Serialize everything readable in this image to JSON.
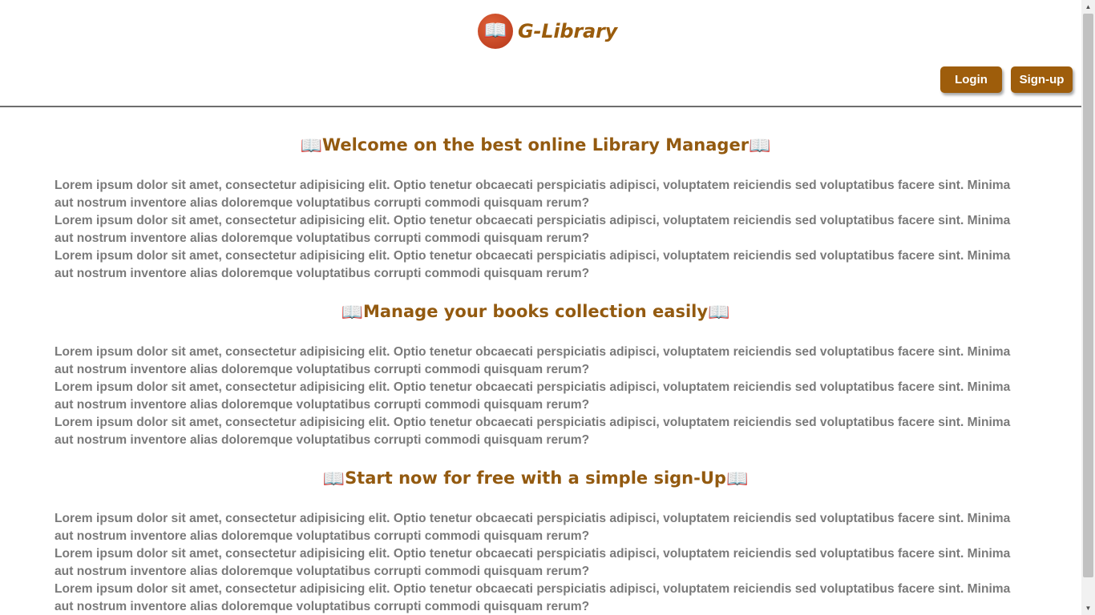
{
  "header": {
    "brand": "G-Library",
    "logo_icon": "open-book-icon",
    "login_label": "Login",
    "signup_label": "Sign-up",
    "accent_color": "#9e5d0b"
  },
  "sections": [
    {
      "title": "Welcome on the best online Library Manager",
      "paragraphs": [
        "Lorem ipsum dolor sit amet, consectetur adipisicing elit. Optio tenetur obcaecati perspiciatis adipisci, voluptatem reiciendis sed voluptatibus facere sint. Minima aut nostrum inventore alias doloremque voluptatibus corrupti commodi quisquam rerum?",
        "Lorem ipsum dolor sit amet, consectetur adipisicing elit. Optio tenetur obcaecati perspiciatis adipisci, voluptatem reiciendis sed voluptatibus facere sint. Minima aut nostrum inventore alias doloremque voluptatibus corrupti commodi quisquam rerum?",
        "Lorem ipsum dolor sit amet, consectetur adipisicing elit. Optio tenetur obcaecati perspiciatis adipisci, voluptatem reiciendis sed voluptatibus facere sint. Minima aut nostrum inventore alias doloremque voluptatibus corrupti commodi quisquam rerum?"
      ]
    },
    {
      "title": "Manage your books collection easily",
      "paragraphs": [
        "Lorem ipsum dolor sit amet, consectetur adipisicing elit. Optio tenetur obcaecati perspiciatis adipisci, voluptatem reiciendis sed voluptatibus facere sint. Minima aut nostrum inventore alias doloremque voluptatibus corrupti commodi quisquam rerum?",
        "Lorem ipsum dolor sit amet, consectetur adipisicing elit. Optio tenetur obcaecati perspiciatis adipisci, voluptatem reiciendis sed voluptatibus facere sint. Minima aut nostrum inventore alias doloremque voluptatibus corrupti commodi quisquam rerum?",
        "Lorem ipsum dolor sit amet, consectetur adipisicing elit. Optio tenetur obcaecati perspiciatis adipisci, voluptatem reiciendis sed voluptatibus facere sint. Minima aut nostrum inventore alias doloremque voluptatibus corrupti commodi quisquam rerum?"
      ]
    },
    {
      "title": "Start now for free with a simple sign-Up",
      "paragraphs": [
        "Lorem ipsum dolor sit amet, consectetur adipisicing elit. Optio tenetur obcaecati perspiciatis adipisci, voluptatem reiciendis sed voluptatibus facere sint. Minima aut nostrum inventore alias doloremque voluptatibus corrupti commodi quisquam rerum?",
        "Lorem ipsum dolor sit amet, consectetur adipisicing elit. Optio tenetur obcaecati perspiciatis adipisci, voluptatem reiciendis sed voluptatibus facere sint. Minima aut nostrum inventore alias doloremque voluptatibus corrupti commodi quisquam rerum?",
        "Lorem ipsum dolor sit amet, consectetur adipisicing elit. Optio tenetur obcaecati perspiciatis adipisci, voluptatem reiciendis sed voluptatibus facere sint. Minima aut nostrum inventore alias doloremque voluptatibus corrupti commodi quisquam rerum?"
      ]
    }
  ],
  "title_icon": "open-book-icon",
  "title_color": "#935a10",
  "text_color": "#7a7a7a"
}
